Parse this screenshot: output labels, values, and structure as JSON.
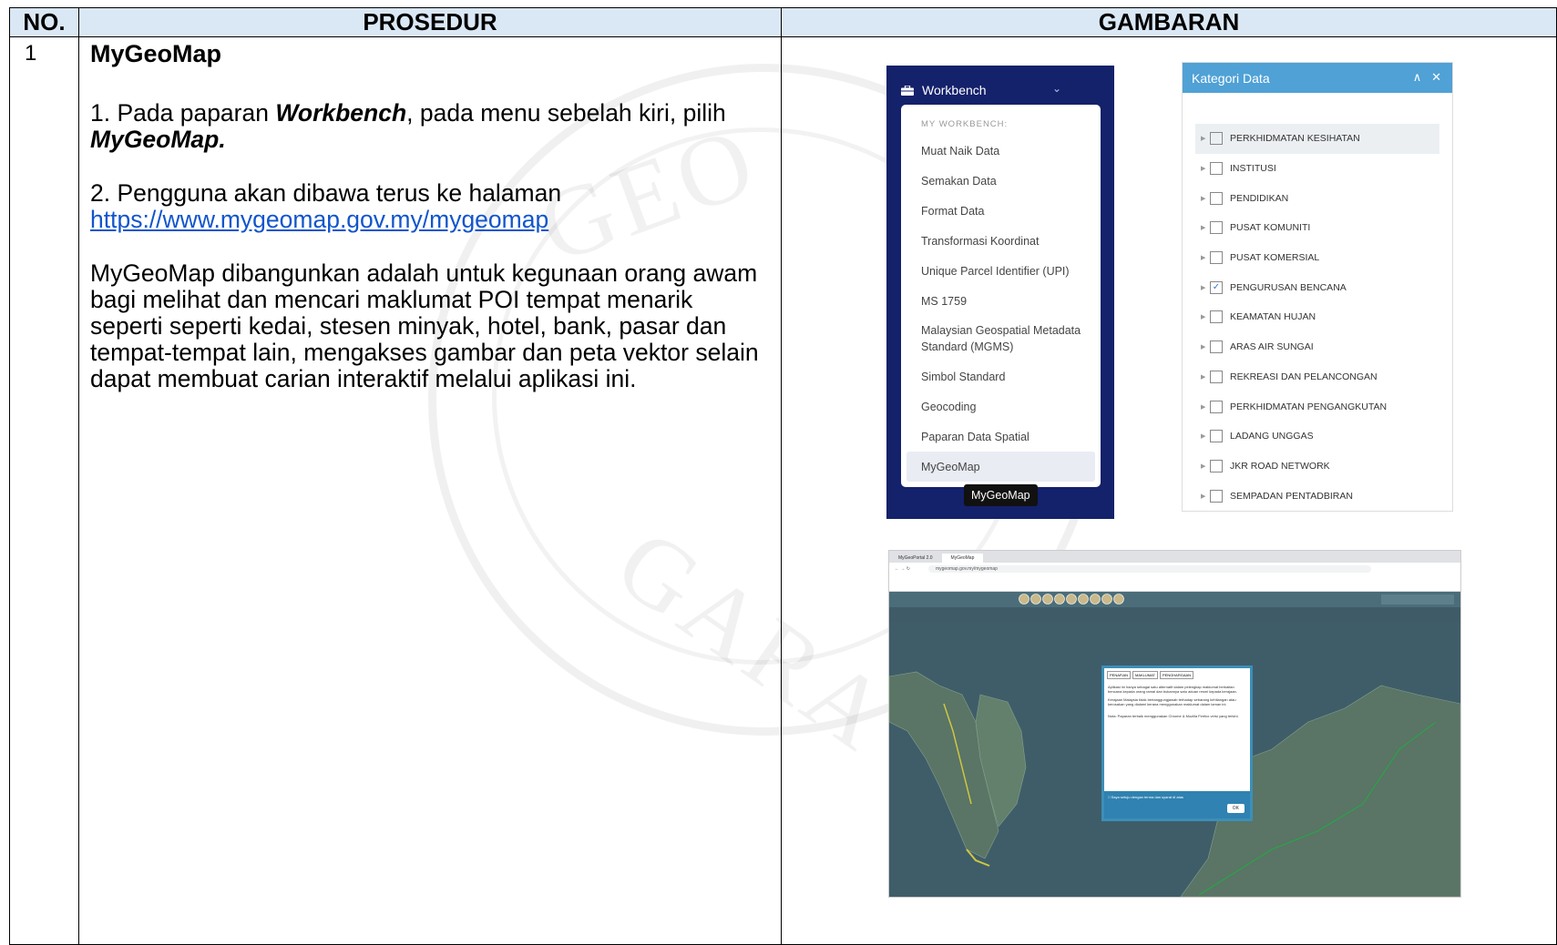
{
  "table": {
    "headers": {
      "no": "NO.",
      "prosedur": "PROSEDUR",
      "gambaran": "GAMBARAN"
    },
    "row": {
      "no": "1",
      "title": "MyGeoMap",
      "step1": {
        "a": "1. Pada paparan ",
        "b": "Workbench",
        "c": ", pada menu sebelah kiri, pilih ",
        "d": "MyGeoMap."
      },
      "step2": {
        "text": "2. Pengguna akan dibawa terus ke halaman ",
        "link": "https://www.mygeomap.gov.my/mygeomap"
      },
      "desc": "MyGeoMap dibangunkan adalah untuk kegunaan orang awam bagi melihat dan mencari maklumat POI tempat menarik seperti seperti kedai, stesen minyak, hotel, bank, pasar dan tempat-tempat lain, mengakses gambar dan peta vektor selain dapat membuat carian interaktif melalui aplikasi ini."
    }
  },
  "workbench": {
    "title": "Workbench",
    "subheader": "MY WORKBENCH:",
    "items": [
      "Muat Naik Data",
      "Semakan Data",
      "Format Data",
      "Transformasi Koordinat",
      "Unique Parcel Identifier (UPI)",
      "MS 1759",
      "Malaysian Geospatial Metadata Standard (MGMS)",
      "Simbol Standard",
      "Geocoding",
      "Paparan Data Spatial",
      "MyGeoMap"
    ],
    "selected": "MyGeoMap",
    "tooltip": "MyGeoMap"
  },
  "kategori": {
    "title": "Kategori Data",
    "items": [
      {
        "label": "PERKHIDMATAN KESIHATAN",
        "checked": false
      },
      {
        "label": "INSTITUSI",
        "checked": false
      },
      {
        "label": "PENDIDIKAN",
        "checked": false
      },
      {
        "label": "PUSAT KOMUNITI",
        "checked": false
      },
      {
        "label": "PUSAT KOMERSIAL",
        "checked": false
      },
      {
        "label": "PENGURUSAN BENCANA",
        "checked": true
      },
      {
        "label": "KEAMATAN HUJAN",
        "checked": false
      },
      {
        "label": "ARAS AIR SUNGAI",
        "checked": false
      },
      {
        "label": "REKREASI DAN PELANCONGAN",
        "checked": false
      },
      {
        "label": "PERKHIDMATAN PENGANGKUTAN",
        "checked": false
      },
      {
        "label": "LADANG UNGGAS",
        "checked": false
      },
      {
        "label": "JKR ROAD NETWORK",
        "checked": false
      },
      {
        "label": "SEMPADAN PENTADBIRAN",
        "checked": false
      }
    ]
  },
  "browser": {
    "tabs": [
      "MyGeoPortal 2.0",
      "MyGeoMap"
    ],
    "url": "mygeomap.gov.my/mygeomap",
    "dialog": {
      "tabs": [
        "PENAFIAN",
        "MAKLUMAT",
        "PENGHARGAAN"
      ],
      "p1": "Aplikasi ini hanya sebagai satu alternatif dalam pelengkap maklumat berkaitan bencana kepada orang ramai dan bukannya satu aduan resmi kepada kerajaan.",
      "p2": "Kerajaan Malaysia tidak bertanggungjawab terhadap sebarang kehilangan atau kerosakan yang dialami kerana menggunakan maklumat dalam laman ini.",
      "p3": "Nota: Paparan terbaik menggunakan Chrome & Mozilla Firefox versi yang terkini.",
      "agree": "Saya setuju dengan terma dan syarat di atas",
      "ok": "OK"
    }
  }
}
